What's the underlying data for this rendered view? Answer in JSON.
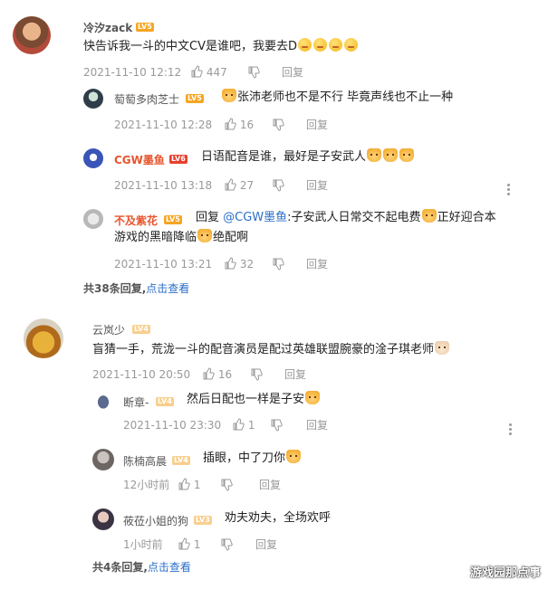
{
  "comments": [
    {
      "user": "冷汐zack",
      "level": "LV5",
      "text": "快告诉我一斗的中文CV是谁吧，我要去D",
      "time": "2021-11-10 12:12",
      "likes": "447",
      "reply": "回复",
      "replies": [
        {
          "user": "萄萄多肉芝士",
          "level": "LV5",
          "text": "张沛老师也不是不行 毕竟声线也不止一种",
          "time": "2021-11-10 12:28",
          "likes": "16",
          "reply": "回复"
        },
        {
          "user": "CGW墨鱼",
          "level": "LV6",
          "text": "日语配音是谁，最好是子安武人",
          "time": "2021-11-10 13:18",
          "likes": "27",
          "reply": "回复"
        },
        {
          "user": "不及紫花",
          "level": "LV5",
          "reply_prefix": "回复",
          "mention": "@CGW墨鱼",
          "text_a": ":子安武人日常交不起电费",
          "text_b": "正好迎合本",
          "text_c": "游戏的黑暗降临",
          "text_d": "绝配啊",
          "time": "2021-11-10 13:21",
          "likes": "32",
          "reply": "回复"
        }
      ],
      "summary_count": "共38条回复,",
      "summary_link": "点击查看"
    },
    {
      "user": "云岚少",
      "level": "LV4",
      "text": "盲猜一手，荒泷一斗的配音演员是配过英雄联盟腕豪的淦子琪老师",
      "time": "2021-11-10 20:50",
      "likes": "16",
      "reply": "回复",
      "replies": [
        {
          "user": "断章-",
          "level": "LV4",
          "text": "然后日配也一样是子安",
          "time": "2021-11-10 23:30",
          "likes": "1",
          "reply": "回复"
        },
        {
          "user": "陈楠高晨",
          "level": "LV4",
          "text": "插眼，中了刀你",
          "time": "12小时前",
          "likes": "1",
          "reply": "回复"
        },
        {
          "user": "莜莅小姐的狗",
          "level": "LV3",
          "text": "劝夫劝夫，全场欢呼",
          "time": "1小时前",
          "likes": "1",
          "reply": "回复"
        }
      ],
      "summary_count": "共4条回复,",
      "summary_link": "点击查看"
    }
  ],
  "watermark": "游戏园那点事",
  "colors": {
    "link": "#2b6fc7",
    "vip_name": "#e8552e",
    "level_badge": "#f5a623"
  },
  "icons": [
    "avatar",
    "level-badge",
    "emoji-icon",
    "like-icon",
    "dislike-icon",
    "more-icon"
  ]
}
